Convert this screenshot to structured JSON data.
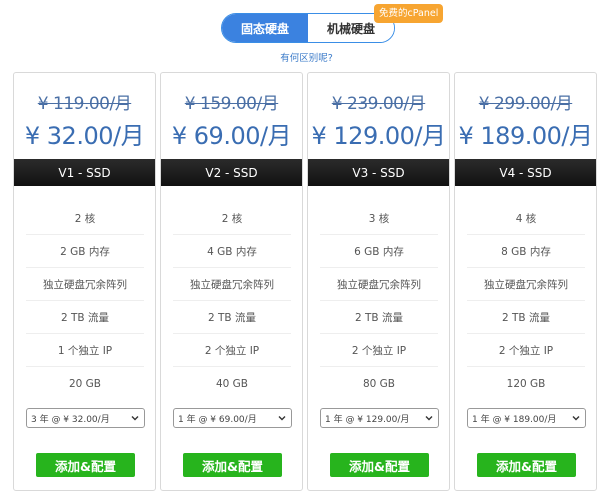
{
  "toggle": {
    "active_label": "固态硬盘",
    "inactive_label": "机械硬盘",
    "badge": "免费的cPanel"
  },
  "diff_link": "有何区别呢?",
  "plans": [
    {
      "old_price": "¥ 119.00/月",
      "price": "¥ 32.00/月",
      "name": "V1 - SSD",
      "features": [
        "2 核",
        "2 GB 内存",
        "独立硬盘冗余阵列",
        "2 TB 流量",
        "1 个独立 IP",
        "20 GB"
      ],
      "term": "3 年 @ ¥ 32.00/月",
      "button": "添加&配置"
    },
    {
      "old_price": "¥ 159.00/月",
      "price": "¥ 69.00/月",
      "name": "V2 - SSD",
      "features": [
        "2 核",
        "4 GB 内存",
        "独立硬盘冗余阵列",
        "2 TB 流量",
        "2 个独立 IP",
        "40 GB"
      ],
      "term": "1 年 @ ¥ 69.00/月",
      "button": "添加&配置"
    },
    {
      "old_price": "¥ 239.00/月",
      "price": "¥ 129.00/月",
      "name": "V3 - SSD",
      "features": [
        "3 核",
        "6 GB 内存",
        "独立硬盘冗余阵列",
        "2 TB 流量",
        "2 个独立 IP",
        "80 GB"
      ],
      "term": "1 年 @ ¥ 129.00/月",
      "button": "添加&配置"
    },
    {
      "old_price": "¥ 299.00/月",
      "price": "¥ 189.00/月",
      "name": "V4 - SSD",
      "features": [
        "4 核",
        "8 GB 内存",
        "独立硬盘冗余阵列",
        "2 TB 流量",
        "2 个独立 IP",
        "120 GB"
      ],
      "term": "1 年 @ ¥ 189.00/月",
      "button": "添加&配置"
    }
  ],
  "colors": {
    "accent": "#3b82e0",
    "badge": "#f7a531",
    "button": "#27b41d",
    "price": "#3a6db2"
  }
}
